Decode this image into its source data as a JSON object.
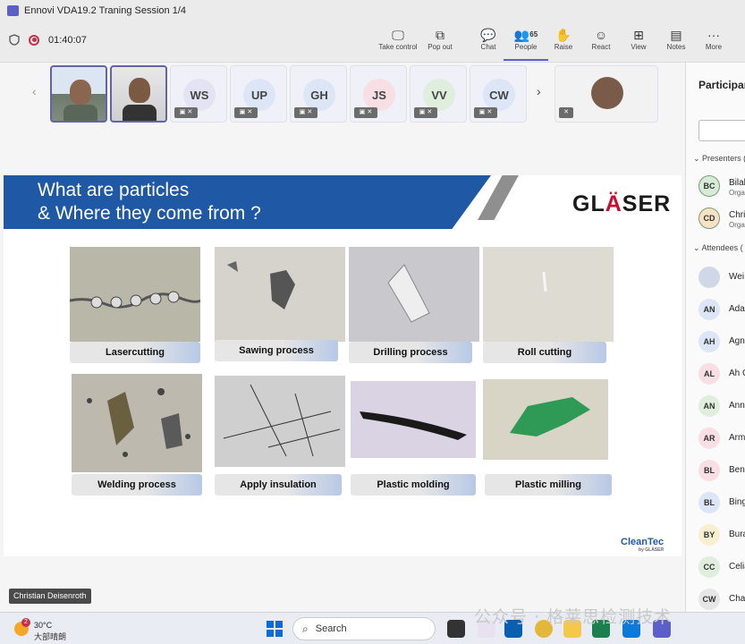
{
  "window": {
    "title": "Ennovi VDA19.2 Traning Session 1/4"
  },
  "meeting": {
    "timer": "01:40:07"
  },
  "toolbar": {
    "take_control": "Take control",
    "pop_out": "Pop out",
    "chat": "Chat",
    "people": "People",
    "people_count": "65",
    "raise": "Raise",
    "react": "React",
    "view": "View",
    "notes": "Notes",
    "more": "More"
  },
  "participant_tiles": [
    {
      "initials": "WS",
      "color": "#e3e3f4"
    },
    {
      "initials": "UP",
      "color": "#dde6f6"
    },
    {
      "initials": "GH",
      "color": "#dde6f6"
    },
    {
      "initials": "JS",
      "color": "#f7dfe3"
    },
    {
      "initials": "VV",
      "color": "#e0eedd"
    },
    {
      "initials": "CW",
      "color": "#dde6f6"
    }
  ],
  "slide": {
    "title_line1": "What are particles",
    "title_line2": "& Where they come from ?",
    "logo_pre": "GL",
    "logo_accent": "Ä",
    "logo_post": "SER",
    "footer_logo": "CleanTec",
    "footer_sub": "by GLÄSER",
    "captions": [
      "Lasercutting",
      "Sawing process",
      "Drilling process",
      "Roll cutting",
      "Welding process",
      "Apply insulation",
      "Plastic molding",
      "Plastic milling"
    ]
  },
  "speaker_label": "Christian Deisenroth",
  "panel": {
    "title": "Participan",
    "presenters_label": "Presenters (",
    "attendees_label": "Attendees (",
    "presenters": [
      {
        "initials": "BC",
        "name": "Bilal",
        "role": "Orga",
        "color": "#d6ecd6"
      },
      {
        "initials": "CD",
        "name": "Chri",
        "role": "Orga",
        "color": "#f7e3c3"
      }
    ],
    "attendees": [
      {
        "initials": "",
        "name": "Wei",
        "color": "#d0d8e8"
      },
      {
        "initials": "AN",
        "name": "Ada",
        "color": "#dde6f6"
      },
      {
        "initials": "AH",
        "name": "Agn",
        "color": "#dde6f6"
      },
      {
        "initials": "AL",
        "name": "Ah C",
        "color": "#f7dfe3"
      },
      {
        "initials": "AN",
        "name": "Ann",
        "color": "#e0eedd"
      },
      {
        "initials": "AR",
        "name": "Arm",
        "color": "#f7dfe3"
      },
      {
        "initials": "BL",
        "name": "Ben",
        "color": "#f7dfe3"
      },
      {
        "initials": "BL",
        "name": "Bing",
        "color": "#dde6f6"
      },
      {
        "initials": "BY",
        "name": "Bura",
        "color": "#f7efd0"
      },
      {
        "initials": "CC",
        "name": "Celia",
        "color": "#e0eedd"
      },
      {
        "initials": "CW",
        "name": "Cha",
        "color": "#e6e6e6"
      }
    ]
  },
  "taskbar": {
    "weather_temp": "30°C",
    "weather_desc": "大部晴朗",
    "weather_badge": "2",
    "search_label": "Search"
  },
  "watermark": "公众号 · 格莱思检测技术"
}
